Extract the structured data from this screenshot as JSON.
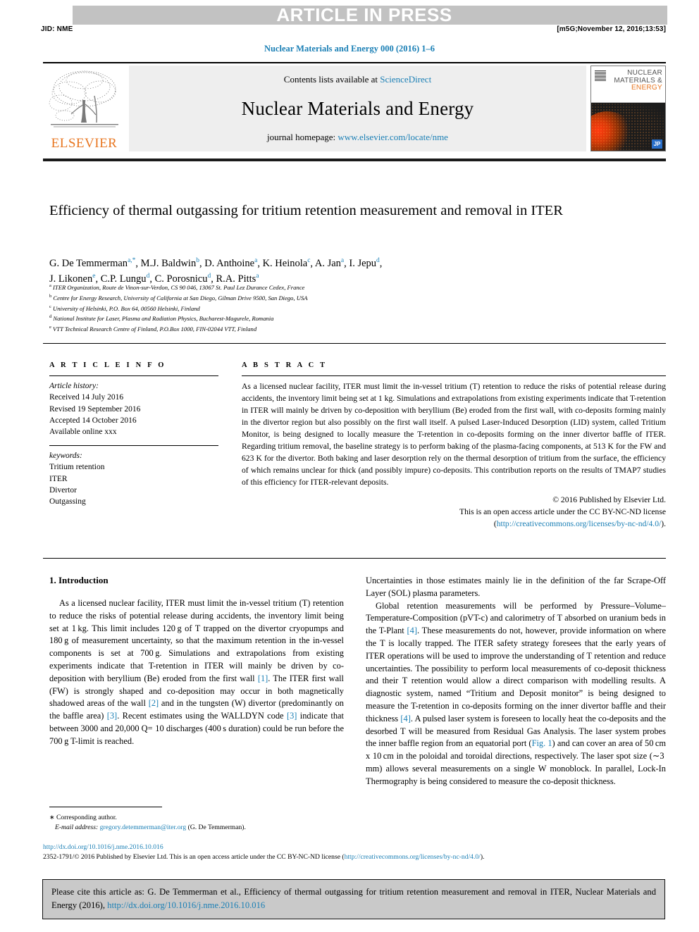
{
  "banner": {
    "text": "ARTICLE IN PRESS",
    "jid": "JID: NME",
    "stamp": "[m5G;November 12, 2016;13:53]",
    "bg_color": "#c2c2c2"
  },
  "journal_ref": "Nuclear Materials and Energy 000 (2016) 1–6",
  "masthead": {
    "publisher": "ELSEVIER",
    "contents_prefix": "Contents lists available at ",
    "contents_link": "ScienceDirect",
    "journal_name": "Nuclear Materials and Energy",
    "homepage_prefix": "journal homepage: ",
    "homepage_link": "www.elsevier.com/locate/nme",
    "cover": {
      "line1": "NUCLEAR",
      "line2": "MATERIALS &",
      "line3": "ENERGY",
      "badge": "JP"
    },
    "link_color": "#1a7fb5",
    "brand_color": "#e87722"
  },
  "article": {
    "title": "Efficiency of thermal outgassing for tritium retention measurement and removal in ITER",
    "authors_line1": "G. De Temmerman",
    "authors": "G. De Temmerman<sup>a,*</sup>, M.J. Baldwin<sup>b</sup>, D. Anthoine<sup>a</sup>, K. Heinola<sup>c</sup>, A. Jan<sup>a</sup>, I. Jepu<sup>d</sup>, J. Likonen<sup>e</sup>, C.P. Lungu<sup>d</sup>, C. Porosnicu<sup>d</sup>, R.A. Pitts<sup>a</sup>",
    "affiliations": [
      {
        "mark": "a",
        "text": "ITER Organization, Route de Vinon-sur-Verdon, CS 90 046, 13067 St. Paul Lez Durance Cedex, France"
      },
      {
        "mark": "b",
        "text": "Centre for Energy Research, University of California at San Diego, Gilman Drive 9500, San Diego, USA"
      },
      {
        "mark": "c",
        "text": "University of Helsinki, P.O. Box 64, 00560 Helsinki, Finland"
      },
      {
        "mark": "d",
        "text": "National Institute for Laser, Plasma and Radiation Physics, Bucharest-Magurele, Romania"
      },
      {
        "mark": "e",
        "text": "VTT Technical Research Centre of Finland, P.O.Box 1000, FIN-02044 VTT, Finland"
      }
    ]
  },
  "article_info": {
    "heading": "A R T I C L E   I N F O",
    "history_label": "Article history:",
    "history": [
      "Received 14 July 2016",
      "Revised 19 September 2016",
      "Accepted 14 October 2016",
      "Available online xxx"
    ],
    "keywords_label": "keywords:",
    "keywords": [
      "Tritium retention",
      "ITER",
      "Divertor",
      "Outgassing"
    ]
  },
  "abstract": {
    "heading": "A B S T R A C T",
    "body": "As a licensed nuclear facility, ITER must limit the in-vessel tritium (T) retention to reduce the risks of potential release during accidents, the inventory limit being set at 1 kg. Simulations and extrapolations from existing experiments indicate that T-retention in ITER will mainly be driven by co-deposition with beryllium (Be) eroded from the first wall, with co-deposits forming mainly in the divertor region but also possibly on the first wall itself. A pulsed Laser-Induced Desorption (LID) system, called Tritium Monitor, is being designed to locally measure the T-retention in co-deposits forming on the inner divertor baffle of ITER. Regarding tritium removal, the baseline strategy is to perform baking of the plasma-facing components, at 513 K for the FW and 623 K for the divertor. Both baking and laser desorption rely on the thermal desorption of tritium from the surface, the efficiency of which remains unclear for thick (and possibly impure) co-deposits. This contribution reports on the results of TMAP7 studies of this efficiency for ITER-relevant deposits.",
    "copyright_line1": "© 2016 Published by Elsevier Ltd.",
    "copyright_line2": "This is an open access article under the CC BY-NC-ND license",
    "copyright_line3_prefix": "(",
    "copyright_link": "http://creativecommons.org/licenses/by-nc-nd/4.0/",
    "copyright_line3_suffix": ")."
  },
  "body": {
    "section_heading": "1. Introduction",
    "left_paragraphs": [
      "As a licensed nuclear facility, ITER must limit the in-vessel tritium (T) retention to reduce the risks of potential release during accidents, the inventory limit being set at 1 kg. This limit includes 120 g of T trapped on the divertor cryopumps and 180 g of measurement uncertainty, so that the maximum retention in the in-vessel components is set at 700 g. Simulations and extrapolations from existing experiments indicate that T-retention in ITER will mainly be driven by co-deposition with beryllium (Be) eroded from the first wall [1]. The ITER first wall (FW) is strongly shaped and co-deposition may occur in both magnetically shadowed areas of the wall [2] and in the tungsten (W) divertor (predominantly on the baffle area) [3]. Recent estimates using the WALLDYN code [3] indicate that between 3000 and 20,000 Q= 10 discharges (400 s duration) could be run before the 700 g T-limit is reached."
    ],
    "right_paragraphs": [
      "Uncertainties in those estimates mainly lie in the definition of the far Scrape-Off Layer (SOL) plasma parameters.",
      "Global retention measurements will be performed by Pressure–Volume–Temperature-Composition (pVT-c) and calorimetry of T absorbed on uranium beds in the T-Plant [4]. These measurements do not, however, provide information on where the T is locally trapped. The ITER safety strategy foresees that the early years of ITER operations will be used to improve the understanding of T retention and reduce uncertainties. The possibility to perform local measurements of co-deposit thickness and their T retention would allow a direct comparison with modelling results. A diagnostic system, named “Tritium and Deposit monitor” is being designed to measure the T-retention in co-deposits forming on the inner divertor baffle and their thickness [4]. A pulsed laser system is foreseen to locally heat the co-deposits and the desorbed T will be measured from Residual Gas Analysis. The laser system probes the inner baffle region from an equatorial port (Fig. 1) and can cover an area of 50 cm x 10 cm in the poloidal and toroidal directions, respectively. The laser spot size (~3 mm) allows several measurements on a single W monoblock. In parallel, Lock-In Thermography is being considered to measure the co-deposit thickness."
    ]
  },
  "footnote": {
    "corresponding": "Corresponding author.",
    "email_label": "E-mail address:",
    "email": "gregory.detemmerman@iter.org",
    "email_suffix": "(G. De Temmerman)."
  },
  "doi_block": {
    "doi_url": "http://dx.doi.org/10.1016/j.nme.2016.10.016",
    "issn_line_prefix": "2352-1791/© 2016 Published by Elsevier Ltd. This is an open access article under the CC BY-NC-ND license (",
    "issn_link": "http://creativecommons.org/licenses/by-nc-nd/4.0/",
    "issn_line_suffix": ")."
  },
  "cite_box": {
    "text_prefix": "Please cite this article as: G. De Temmerman et al., Efficiency of thermal outgassing for tritium retention measurement and removal in ITER, Nuclear Materials and Energy (2016), ",
    "link": "http://dx.doi.org/10.1016/j.nme.2016.10.016"
  }
}
